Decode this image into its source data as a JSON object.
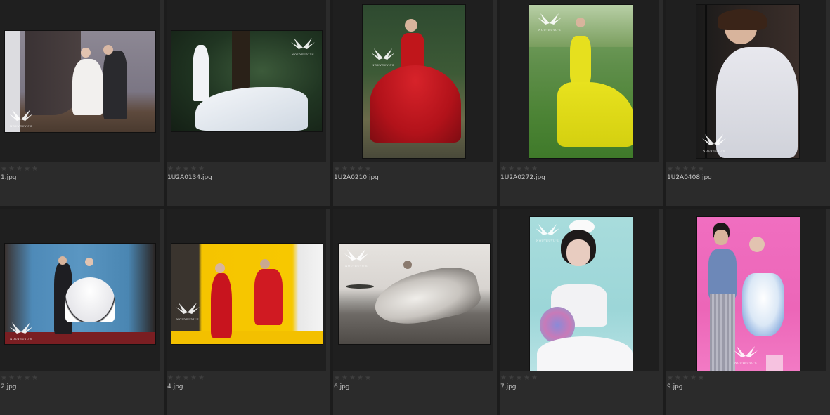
{
  "thumbnails": [
    {
      "filename": "1.jpg",
      "rating": 0
    },
    {
      "filename": "1U2A0134.jpg",
      "rating": 0
    },
    {
      "filename": "1U2A0210.jpg",
      "rating": 0
    },
    {
      "filename": "1U2A0272.jpg",
      "rating": 0
    },
    {
      "filename": "1U2A0408.jpg",
      "rating": 0
    },
    {
      "filename": "2.jpg",
      "rating": 0
    },
    {
      "filename": "4.jpg",
      "rating": 0
    },
    {
      "filename": "6.jpg",
      "rating": 0
    },
    {
      "filename": "7.jpg",
      "rating": 0
    },
    {
      "filename": "9.jpg",
      "rating": 0
    }
  ],
  "watermark": {
    "brand": "NOUYEUYU'S"
  },
  "colors": {
    "background": "#1c1c1c",
    "cell": "#2b2b2b",
    "thumb_area": "#1f1f1f",
    "star": "#3f3f3f",
    "text": "#c8c8c8"
  },
  "icons": {
    "star": "star-icon",
    "watermark": "wing-logo-icon"
  }
}
